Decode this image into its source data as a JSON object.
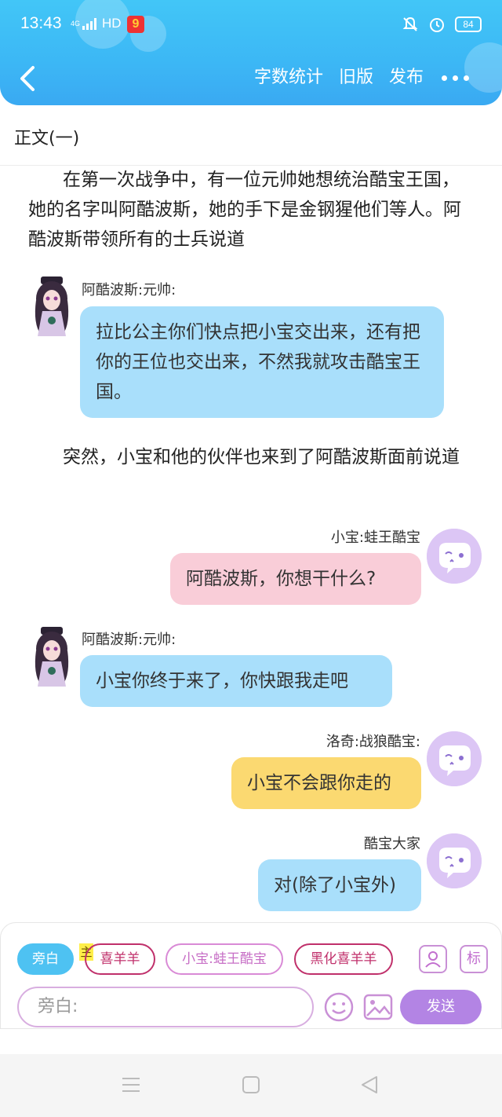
{
  "status_bar": {
    "time": "13:43",
    "network": "4G",
    "network_label": "HD",
    "app_badge": "9",
    "battery": "84"
  },
  "nav": {
    "word_count": "字数统计",
    "old_version": "旧版",
    "publish": "发布"
  },
  "section_title": "正文(一)",
  "paragraphs": [
    "在第一次战争中，有一位元帅她想统治酷宝王国，她的名字叫阿酷波斯，她的手下是金钢猩他们等人。阿酷波斯带领所有的士兵说道",
    "突然，小宝和他的伙伴也来到了阿酷波斯面前说道"
  ],
  "messages": [
    {
      "speaker": "阿酷波斯:元帅:",
      "text": "拉比公主你们快点把小宝交出来，还有把你的王位也交出来，不然我就攻击酷宝王国。",
      "side": "left",
      "color": "#a9dffb"
    },
    {
      "speaker": "小宝:蛙王酷宝",
      "text": "阿酷波斯，你想干什么?",
      "side": "right",
      "color": "#f9cdd8"
    },
    {
      "speaker": "阿酷波斯:元帅:",
      "text": "小宝你终于来了，你快跟我走吧",
      "side": "left",
      "color": "#a9dffb"
    },
    {
      "speaker": "洛奇:战狼酷宝:",
      "text": "小宝不会跟你走的",
      "side": "right",
      "color": "#fbd971"
    },
    {
      "speaker": "酷宝大家",
      "text": "对(除了小宝外)",
      "side": "right",
      "color": "#a9dffb"
    }
  ],
  "composer": {
    "chips": [
      "旁白",
      "喜羊羊",
      "小宝:蛙王酷宝",
      "黑化喜羊羊"
    ],
    "main_tag": "主",
    "mark_label": "标",
    "input_placeholder": "旁白:",
    "send_label": "发送"
  },
  "colors": {
    "header": "#3cb7f5",
    "accent_purple": "#b384e4",
    "chip_active": "#4ec2f2"
  }
}
